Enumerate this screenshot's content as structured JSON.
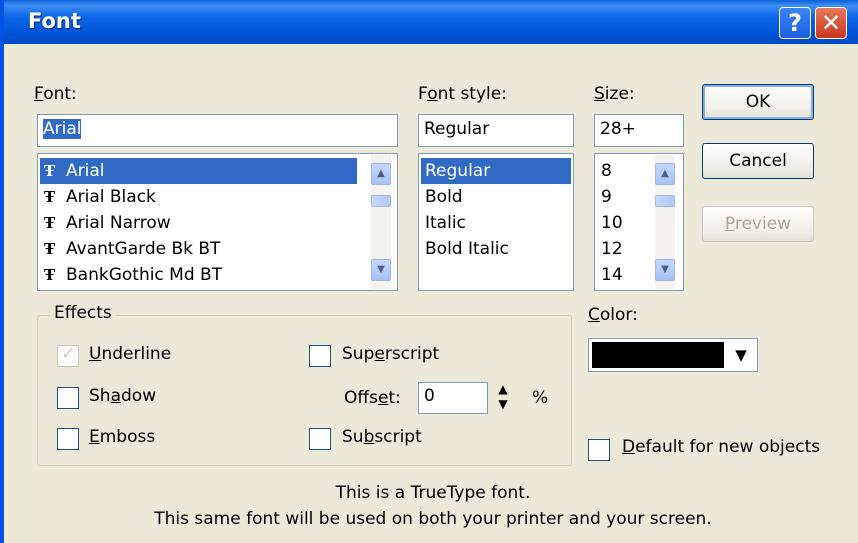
{
  "window": {
    "title": "Font",
    "help_button": "?",
    "close_button": "✕"
  },
  "font": {
    "label_prefix": "",
    "label_mnemonic": "F",
    "label_rest": "ont:",
    "value": "Arial",
    "items": [
      "Arial",
      "Arial Black",
      "Arial Narrow",
      "AvantGarde Bk BT",
      "BankGothic Md BT"
    ],
    "selected_index": 0
  },
  "font_style": {
    "label_prefix": "F",
    "label_mnemonic": "o",
    "label_rest": "nt style:",
    "value": "Regular",
    "items": [
      "Regular",
      "Bold",
      "Italic",
      "Bold Italic"
    ],
    "selected_index": 0
  },
  "size": {
    "label_prefix": "",
    "label_mnemonic": "S",
    "label_rest": "ize:",
    "value": "28+",
    "items": [
      "8",
      "9",
      "10",
      "12",
      "14"
    ]
  },
  "buttons": {
    "ok": "OK",
    "cancel": "Cancel",
    "preview_prefix": "",
    "preview_mnemonic": "P",
    "preview_rest": "review",
    "preview_enabled": false
  },
  "effects": {
    "title": "Effects",
    "underline": {
      "prefix": "",
      "mnemonic": "U",
      "rest": "nderline",
      "checked": true,
      "enabled": false
    },
    "shadow": {
      "prefix": "Sh",
      "mnemonic": "a",
      "rest": "dow",
      "checked": false
    },
    "emboss": {
      "prefix": "",
      "mnemonic": "E",
      "rest": "mboss",
      "checked": false
    },
    "superscript": {
      "prefix": "Sup",
      "mnemonic": "e",
      "rest": "rscript",
      "checked": false
    },
    "subscript": {
      "prefix": "Su",
      "mnemonic": "b",
      "rest": "script",
      "checked": false
    },
    "offset": {
      "prefix": "Offs",
      "mnemonic": "e",
      "rest": "t:",
      "value": "0",
      "unit": "%"
    }
  },
  "color": {
    "label_prefix": "",
    "label_mnemonic": "C",
    "label_rest": "olor:",
    "value": "#000000"
  },
  "default_for_new": {
    "prefix": "",
    "mnemonic": "D",
    "rest": "efault for new objects",
    "checked": false
  },
  "info": {
    "line1": "This is a TrueType font.",
    "line2": "This same font will be used on both your printer and your screen."
  },
  "icons": {
    "truetype": "Ŧ",
    "scroll_up": "▲",
    "scroll_down": "▼",
    "dropdown": "▼",
    "spin_up": "▲",
    "spin_down": "▼",
    "check": "✓"
  }
}
